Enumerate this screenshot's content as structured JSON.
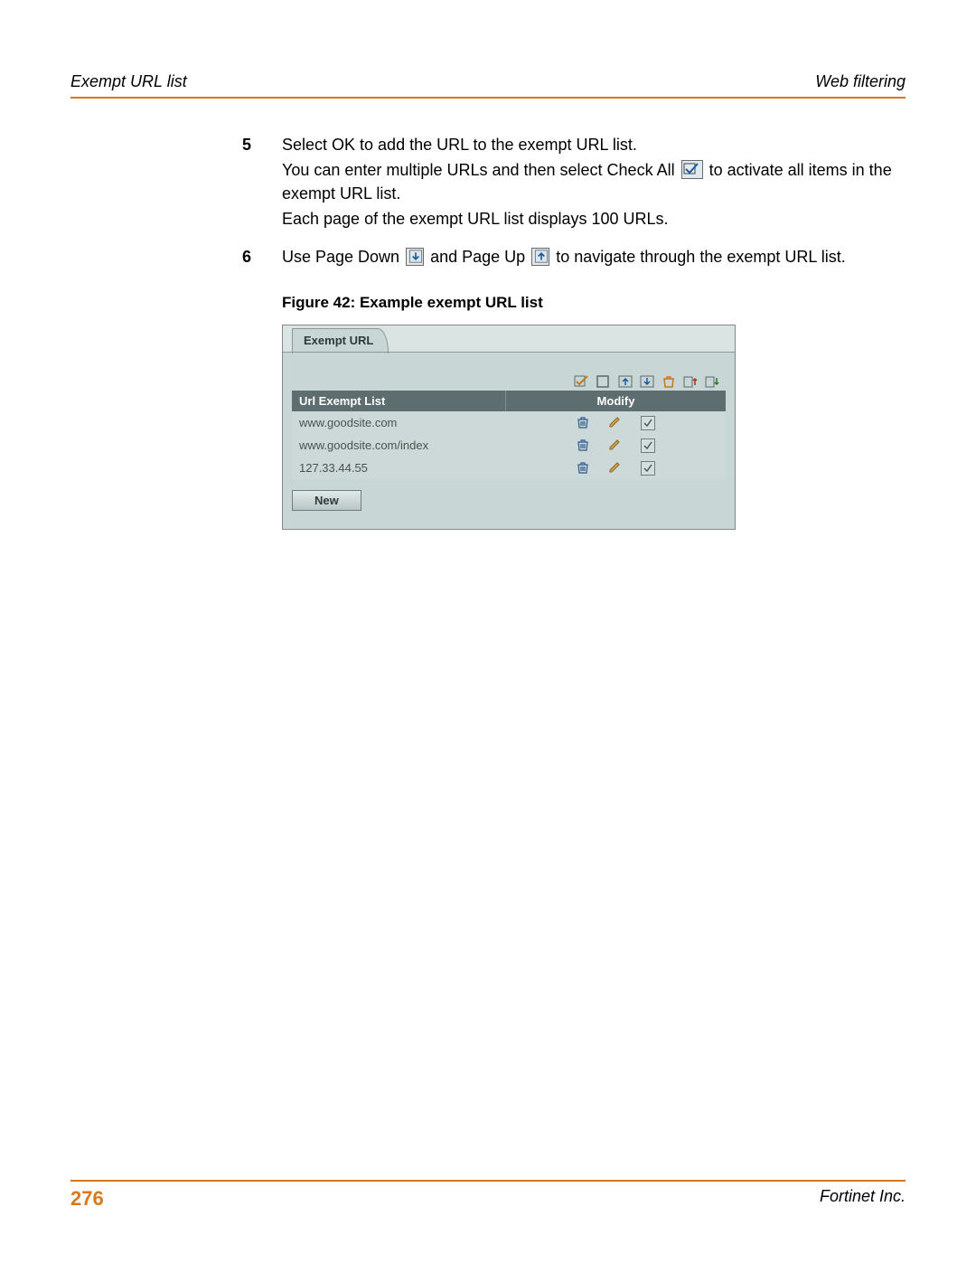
{
  "header": {
    "left": "Exempt URL list",
    "right": "Web filtering"
  },
  "steps": [
    {
      "num": "5",
      "lines": [
        "Select OK to add the URL to the exempt URL list.",
        {
          "pre": "You can enter multiple URLs and then select Check All ",
          "icon": "check-all-icon",
          "post": " to activate all items in the exempt URL list."
        },
        "Each page of the exempt URL list displays 100 URLs."
      ]
    },
    {
      "num": "6",
      "lines": [
        {
          "pre": "Use Page Down ",
          "icon": "page-down-icon",
          "mid": " and Page Up ",
          "icon2": "page-up-icon",
          "post": " to navigate through the exempt URL list."
        }
      ]
    }
  ],
  "figure_caption": "Figure 42: Example exempt URL list",
  "panel": {
    "tab_label": "Exempt URL",
    "columns": {
      "url": "Url Exempt List",
      "modify": "Modify"
    },
    "rows": [
      {
        "url": "www.goodsite.com"
      },
      {
        "url": "www.goodsite.com/index"
      },
      {
        "url": "127.33.44.55"
      }
    ],
    "new_button": "New"
  },
  "footer": {
    "page_number": "276",
    "right": "Fortinet Inc."
  }
}
